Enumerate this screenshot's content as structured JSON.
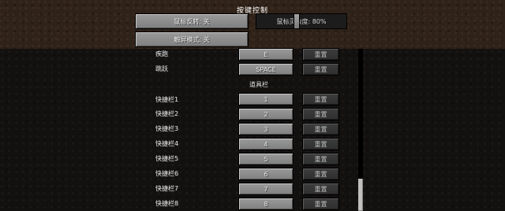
{
  "title": "按键控制",
  "top": {
    "invert_mouse": "鼠标反转: 关",
    "sensitivity": "鼠标灵敏度: 80%",
    "touch_mode": "触屏模式: 关"
  },
  "movement_rows": [
    {
      "label": "疾跑",
      "key": "E",
      "reset": "重置"
    },
    {
      "label": "跳跃",
      "key": "SPACE",
      "reset": "重置"
    }
  ],
  "hotbar_section": "道具栏",
  "hotbar_rows": [
    {
      "label": "快捷栏1",
      "key": "1",
      "reset": "重置"
    },
    {
      "label": "快捷栏2",
      "key": "2",
      "reset": "重置"
    },
    {
      "label": "快捷栏3",
      "key": "3",
      "reset": "重置"
    },
    {
      "label": "快捷栏4",
      "key": "4",
      "reset": "重置"
    },
    {
      "label": "快捷栏5",
      "key": "5",
      "reset": "重置"
    },
    {
      "label": "快捷栏6",
      "key": "6",
      "reset": "重置"
    },
    {
      "label": "快捷栏7",
      "key": "7",
      "reset": "重置"
    },
    {
      "label": "快捷栏8",
      "key": "8",
      "reset": "重置"
    }
  ],
  "sensitivity_level": 0.8
}
